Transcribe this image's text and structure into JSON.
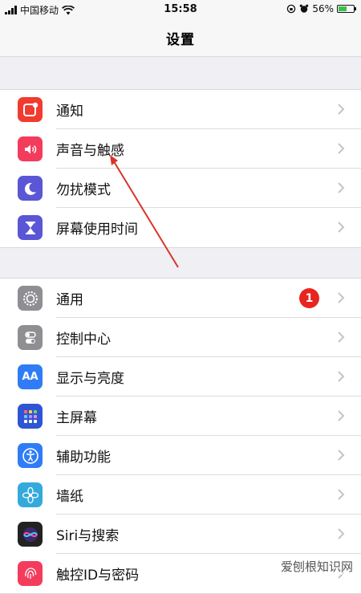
{
  "status_bar": {
    "carrier": "中国移动",
    "time": "15:58",
    "battery": "56%",
    "battery_level": 0.56
  },
  "nav": {
    "title": "设置"
  },
  "group1": [
    {
      "label": "通知",
      "icon": "notifications-icon",
      "color": "#f23b30"
    },
    {
      "label": "声音与触感",
      "icon": "sounds-icon",
      "color": "#f33c5c"
    },
    {
      "label": "勿扰模式",
      "icon": "do-not-disturb-moon-icon",
      "color": "#5a56d6"
    },
    {
      "label": "屏幕使用时间",
      "icon": "screen-time-hourglass-icon",
      "color": "#5a56d6"
    }
  ],
  "group2": [
    {
      "label": "通用",
      "icon": "gear-icon",
      "color": "#8e8e93",
      "badge": "1"
    },
    {
      "label": "控制中心",
      "icon": "control-center-icon",
      "color": "#8e8e93"
    },
    {
      "label": "显示与亮度",
      "icon": "display-aa-icon",
      "color": "#2f7cf6"
    },
    {
      "label": "主屏幕",
      "icon": "home-screen-icon",
      "color": "#2f55d4"
    },
    {
      "label": "辅助功能",
      "icon": "accessibility-icon",
      "color": "#2f7cf6"
    },
    {
      "label": "墙纸",
      "icon": "wallpaper-flower-icon",
      "color": "#34aadc"
    },
    {
      "label": "Siri与搜索",
      "icon": "siri-icon",
      "color": "#222222"
    },
    {
      "label": "触控ID与密码",
      "icon": "touch-id-fingerprint-icon",
      "color": "#f33c5c"
    }
  ],
  "annotation_color": "#d9342b",
  "watermark": "爱刨根知识网"
}
